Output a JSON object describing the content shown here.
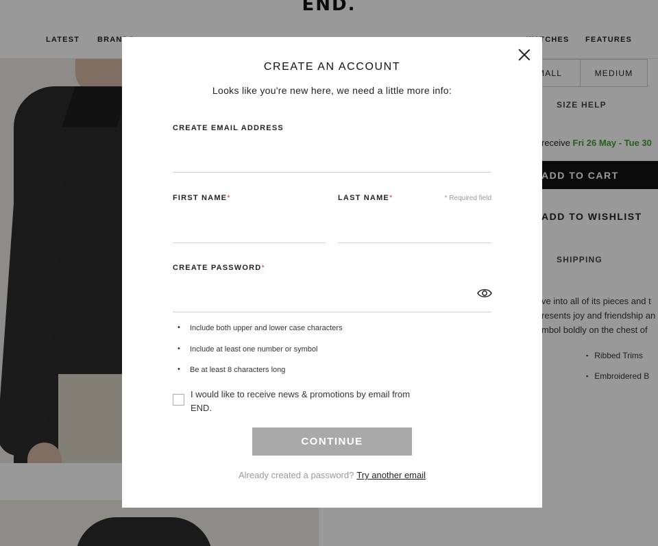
{
  "background": {
    "logo": "END.",
    "nav": [
      "LATEST",
      "BRANDS",
      "WATCHES",
      "FEATURES"
    ],
    "sizes": [
      "SMALL",
      "MEDIUM"
    ],
    "size_help": "SIZE HELP",
    "delivery_prefix": "receive ",
    "delivery_date": "Fri 26 May - Tue 30",
    "add_to_cart": "ADD TO CART",
    "add_to_wishlist": "ADD TO WISHLIST",
    "shipping_tab": "SHIPPING",
    "description": [
      "ve into all of its pieces and t",
      "resents joy and friendship an",
      "mbol boldly on the chest of"
    ],
    "features": [
      "Ribbed Trims",
      "Embroidered B"
    ]
  },
  "modal": {
    "title": "CREATE AN ACCOUNT",
    "subtitle": "Looks like you're new here, we need a little more info:",
    "email_label": "CREATE EMAIL ADDRESS",
    "email_value": "",
    "first_name_label": "FIRST NAME",
    "first_name_value": "",
    "last_name_label": "LAST NAME",
    "last_name_value": "",
    "required_marker": "*",
    "required_note": "* Required field",
    "password_label": "CREATE PASSWORD",
    "password_value": "",
    "password_rules": [
      "Include both upper and lower case characters",
      "Include at least one number or symbol",
      "Be at least 8 characters long"
    ],
    "newsletter_label": "I would like to receive news & promotions by email from END.",
    "newsletter_checked": false,
    "continue_label": "CONTINUE",
    "already_text": "Already created a password?",
    "try_another_link": "Try another email"
  }
}
